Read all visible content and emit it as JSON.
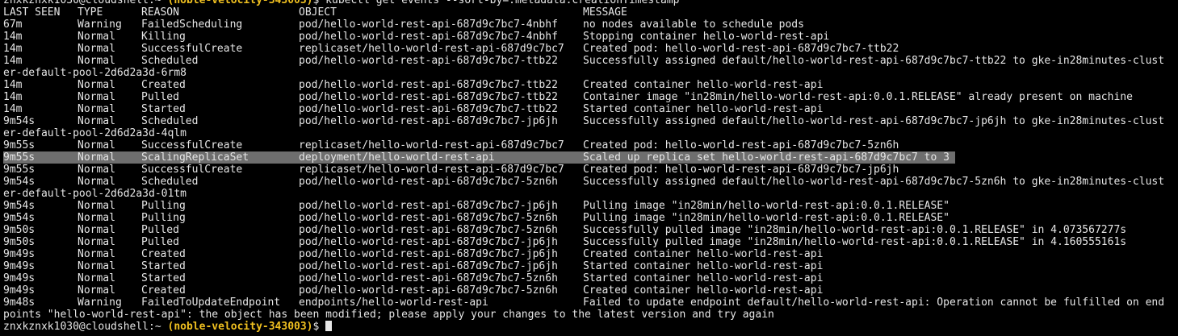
{
  "prompt": {
    "user_host": "znxkznxk1030@cloudshell:~",
    "project": "(noble-velocity-343003)",
    "symbol": "$"
  },
  "command": "kubectl get events --sort-by=.metadata.creationTimestamp",
  "headers": [
    "LAST SEEN",
    "TYPE",
    "REASON",
    "OBJECT",
    "MESSAGE"
  ],
  "events": [
    {
      "last_seen": "67m",
      "type": "Warning",
      "reason": "FailedScheduling",
      "object": "pod/hello-world-rest-api-687d9c7bc7-4nbhf",
      "message": "no nodes available to schedule pods",
      "cont": ""
    },
    {
      "last_seen": "14m",
      "type": "Normal",
      "reason": "Killing",
      "object": "pod/hello-world-rest-api-687d9c7bc7-4nbhf",
      "message": "Stopping container hello-world-rest-api",
      "cont": ""
    },
    {
      "last_seen": "14m",
      "type": "Normal",
      "reason": "SuccessfulCreate",
      "object": "replicaset/hello-world-rest-api-687d9c7bc7",
      "message": "Created pod: hello-world-rest-api-687d9c7bc7-ttb22",
      "cont": ""
    },
    {
      "last_seen": "14m",
      "type": "Normal",
      "reason": "Scheduled",
      "object": "pod/hello-world-rest-api-687d9c7bc7-ttb22",
      "message": "Successfully assigned default/hello-world-rest-api-687d9c7bc7-ttb22 to gke-in28minutes-clust",
      "cont": "er-default-pool-2d6d2a3d-6rm8"
    },
    {
      "last_seen": "14m",
      "type": "Normal",
      "reason": "Created",
      "object": "pod/hello-world-rest-api-687d9c7bc7-ttb22",
      "message": "Created container hello-world-rest-api",
      "cont": ""
    },
    {
      "last_seen": "14m",
      "type": "Normal",
      "reason": "Pulled",
      "object": "pod/hello-world-rest-api-687d9c7bc7-ttb22",
      "message": "Container image \"in28min/hello-world-rest-api:0.0.1.RELEASE\" already present on machine",
      "cont": ""
    },
    {
      "last_seen": "14m",
      "type": "Normal",
      "reason": "Started",
      "object": "pod/hello-world-rest-api-687d9c7bc7-ttb22",
      "message": "Started container hello-world-rest-api",
      "cont": ""
    },
    {
      "last_seen": "9m54s",
      "type": "Normal",
      "reason": "Scheduled",
      "object": "pod/hello-world-rest-api-687d9c7bc7-jp6jh",
      "message": "Successfully assigned default/hello-world-rest-api-687d9c7bc7-jp6jh to gke-in28minutes-clust",
      "cont": "er-default-pool-2d6d2a3d-4qlm"
    },
    {
      "last_seen": "9m55s",
      "type": "Normal",
      "reason": "SuccessfulCreate",
      "object": "replicaset/hello-world-rest-api-687d9c7bc7",
      "message": "Created pod: hello-world-rest-api-687d9c7bc7-5zn6h",
      "cont": ""
    },
    {
      "last_seen": "9m55s",
      "type": "Normal",
      "reason": "ScalingReplicaSet",
      "object": "deployment/hello-world-rest-api",
      "message": "Scaled up replica set hello-world-rest-api-687d9c7bc7 to 3",
      "cont": "",
      "highlighted": true
    },
    {
      "last_seen": "9m55s",
      "type": "Normal",
      "reason": "SuccessfulCreate",
      "object": "replicaset/hello-world-rest-api-687d9c7bc7",
      "message": "Created pod: hello-world-rest-api-687d9c7bc7-jp6jh",
      "cont": ""
    },
    {
      "last_seen": "9m54s",
      "type": "Normal",
      "reason": "Scheduled",
      "object": "pod/hello-world-rest-api-687d9c7bc7-5zn6h",
      "message": "Successfully assigned default/hello-world-rest-api-687d9c7bc7-5zn6h to gke-in28minutes-clust",
      "cont": "er-default-pool-2d6d2a3d-01tm"
    },
    {
      "last_seen": "9m54s",
      "type": "Normal",
      "reason": "Pulling",
      "object": "pod/hello-world-rest-api-687d9c7bc7-jp6jh",
      "message": "Pulling image \"in28min/hello-world-rest-api:0.0.1.RELEASE\"",
      "cont": ""
    },
    {
      "last_seen": "9m54s",
      "type": "Normal",
      "reason": "Pulling",
      "object": "pod/hello-world-rest-api-687d9c7bc7-5zn6h",
      "message": "Pulling image \"in28min/hello-world-rest-api:0.0.1.RELEASE\"",
      "cont": ""
    },
    {
      "last_seen": "9m50s",
      "type": "Normal",
      "reason": "Pulled",
      "object": "pod/hello-world-rest-api-687d9c7bc7-5zn6h",
      "message": "Successfully pulled image \"in28min/hello-world-rest-api:0.0.1.RELEASE\" in 4.073567277s",
      "cont": ""
    },
    {
      "last_seen": "9m50s",
      "type": "Normal",
      "reason": "Pulled",
      "object": "pod/hello-world-rest-api-687d9c7bc7-jp6jh",
      "message": "Successfully pulled image \"in28min/hello-world-rest-api:0.0.1.RELEASE\" in 4.160555161s",
      "cont": ""
    },
    {
      "last_seen": "9m49s",
      "type": "Normal",
      "reason": "Created",
      "object": "pod/hello-world-rest-api-687d9c7bc7-jp6jh",
      "message": "Created container hello-world-rest-api",
      "cont": ""
    },
    {
      "last_seen": "9m49s",
      "type": "Normal",
      "reason": "Started",
      "object": "pod/hello-world-rest-api-687d9c7bc7-jp6jh",
      "message": "Started container hello-world-rest-api",
      "cont": ""
    },
    {
      "last_seen": "9m49s",
      "type": "Normal",
      "reason": "Started",
      "object": "pod/hello-world-rest-api-687d9c7bc7-5zn6h",
      "message": "Started container hello-world-rest-api",
      "cont": ""
    },
    {
      "last_seen": "9m49s",
      "type": "Normal",
      "reason": "Created",
      "object": "pod/hello-world-rest-api-687d9c7bc7-5zn6h",
      "message": "Created container hello-world-rest-api",
      "cont": ""
    },
    {
      "last_seen": "9m48s",
      "type": "Warning",
      "reason": "FailedToUpdateEndpoint",
      "object": "endpoints/hello-world-rest-api",
      "message": "Failed to update endpoint default/hello-world-rest-api: Operation cannot be fulfilled on end",
      "cont": "points \"hello-world-rest-api\": the object has been modified; please apply your changes to the latest version and try again"
    }
  ],
  "colors": {
    "background": "#000000",
    "text": "#e6e6e6",
    "project": "#f0c020",
    "selection": "#6e6e6e"
  }
}
